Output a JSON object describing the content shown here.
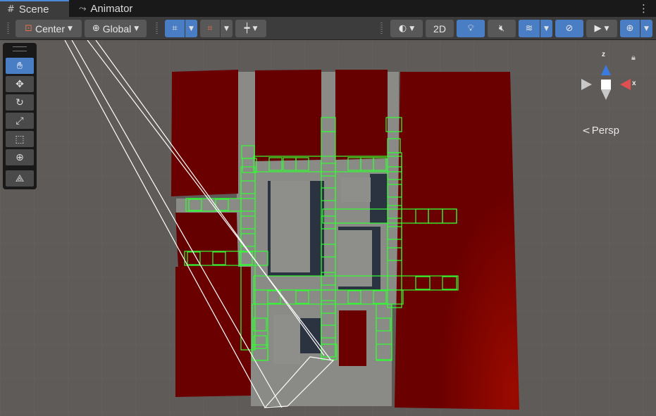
{
  "tabs": [
    {
      "label": "Scene",
      "icon": "grid-icon",
      "active": true
    },
    {
      "label": "Animator",
      "icon": "animator-icon",
      "active": false
    }
  ],
  "toolbar": {
    "pivot_label": "Center",
    "handle_label": "Global",
    "mode_2d_label": "2D"
  },
  "tools": [
    "hand-tool",
    "move-tool",
    "rotate-tool",
    "scale-tool",
    "rect-tool",
    "transform-tool",
    "custom-editor-tool"
  ],
  "gizmo": {
    "projection_label": "Persp",
    "axis_y": "z",
    "axis_x": "x"
  },
  "colors": {
    "accent": "#4a7ec4",
    "wall_red": "#6b0000",
    "floor_gray": "#8a8a86",
    "collider_green": "#33ff33",
    "background": "#5e5a57"
  }
}
